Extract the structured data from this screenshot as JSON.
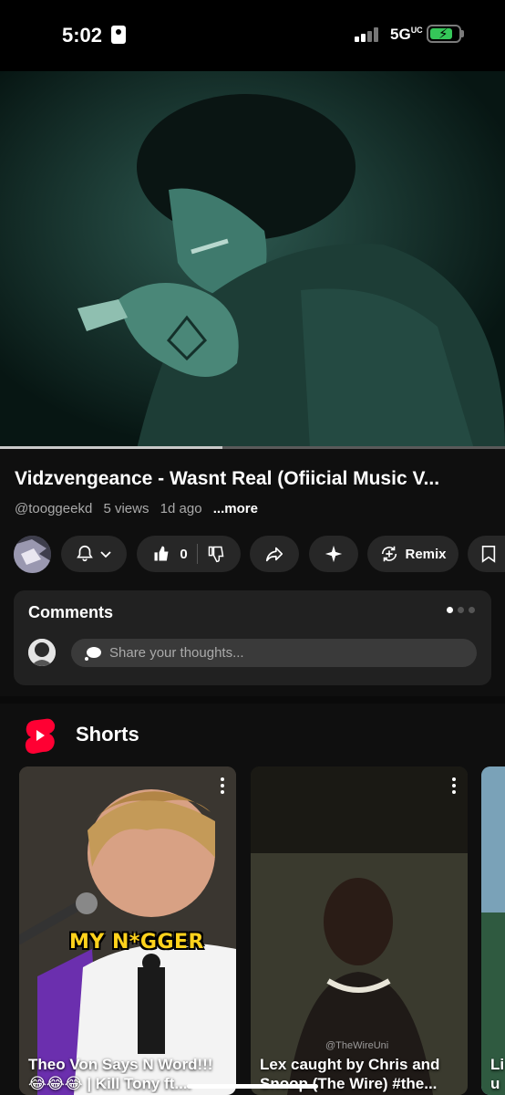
{
  "status_bar": {
    "time": "5:02",
    "network": "5G",
    "network_suffix": "UC",
    "battery_level": 0.8
  },
  "video": {
    "title": "Vidzvengeance - Wasnt Real (Ofiicial Music V...",
    "channel_handle": "@tooggeekd",
    "views": "5 views",
    "age": "1d ago",
    "more_label": "...more",
    "progress": 0.44
  },
  "actions": {
    "like_count": "0",
    "remix_label": "Remix"
  },
  "comments": {
    "title": "Comments",
    "placeholder": "Share your thoughts..."
  },
  "shorts": {
    "heading": "Shorts",
    "items": [
      {
        "title_line1": "Theo Von Says N Word!!!",
        "title_line2": "😂😂😂 | Kill Tony ft....",
        "caption": "MY N*GGER"
      },
      {
        "title_line1": "Lex caught by Chris and",
        "title_line2": "Snoop (The Wire) #the...",
        "watermark": "@TheWireUni"
      },
      {
        "title_line1": "Li",
        "title_line2": "u"
      }
    ]
  },
  "colors": {
    "background": "#0f0f0f",
    "surface": "#272727",
    "shorts_red": "#ff0033",
    "battery_green": "#35c759"
  }
}
